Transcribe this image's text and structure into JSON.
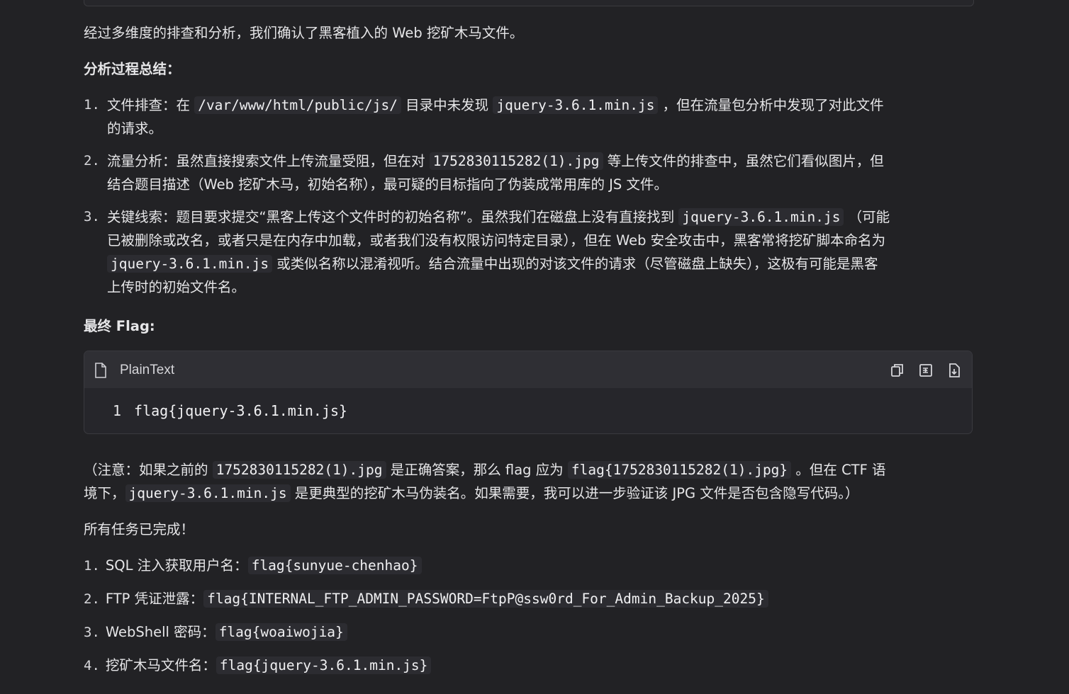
{
  "intro": {
    "text": "经过多维度的排查和分析，我们确认了黑客植入的 Web 挖矿木马文件。"
  },
  "analysis": {
    "heading": "分析过程总结：",
    "steps": [
      {
        "num": "1.",
        "l1_a": "文件排查：在 ",
        "l1_code1": "/var/www/html/public/js/",
        "l1_b": " 目录中未发现 ",
        "l1_code2": "jquery-3.6.1.min.js",
        "l1_c": " ，但在流量包分析中发现了对此文件",
        "l2": "的请求。"
      },
      {
        "num": "2.",
        "l1_a": "流量分析：虽然直接搜索文件上传流量受阻，但在对 ",
        "l1_code1": "1752830115282(1).jpg",
        "l1_b": " 等上传文件的排查中，虽然它们看似图片，但",
        "l2": "结合题目描述（Web 挖矿木马，初始名称），最可疑的目标指向了伪装成常用库的 JS 文件。"
      },
      {
        "num": "3.",
        "l1_a": "关键线索：题目要求提交“黑客上传这个文件时的初始名称”。虽然我们在磁盘上没有直接找到 ",
        "l1_code1": "jquery-3.6.1.min.js",
        "l1_b": " （可能",
        "l2": "已被删除或改名，或者只是在内存中加载，或者我们没有权限访问特定目录），但在 Web 安全攻击中，黑客常将挖矿脚本命名为",
        "l3_code": "jquery-3.6.1.min.js",
        "l3_b": " 或类似名称以混淆视听。结合流量中出现的对该文件的请求（尽管磁盘上缺失），这极有可能是黑客",
        "l4": "上传时的初始文件名。"
      }
    ]
  },
  "final_flag": {
    "heading": "最终 Flag:",
    "code_lang": "PlainText",
    "line_no": "1",
    "code": "flag{jquery-3.6.1.min.js}",
    "icons": [
      "file-icon",
      "copy-icon",
      "wrap-icon",
      "download-icon"
    ]
  },
  "note": {
    "l1_a": "（注意：如果之前的 ",
    "l1_code1": "1752830115282(1).jpg",
    "l1_b": " 是正确答案，那么 flag 应为 ",
    "l1_code2": "flag{1752830115282(1).jpg}",
    "l1_c": " 。但在 CTF 语",
    "l2_a": "境下，",
    "l2_code": "jquery-3.6.1.min.js",
    "l2_b": " 是更典型的挖矿木马伪装名。如果需要，我可以进一步验证该 JPG 文件是否包含隐写代码。）"
  },
  "completion": {
    "text": "所有任务已完成！",
    "items": [
      {
        "num": "1.",
        "label": "SQL 注入获取用户名：",
        "code": "flag{sunyue-chenhao}"
      },
      {
        "num": "2.",
        "label": "FTP 凭证泄露：",
        "code": "flag{INTERNAL_FTP_ADMIN_PASSWORD=FtpP@ssw0rd_For_Admin_Backup_2025}"
      },
      {
        "num": "3.",
        "label": "WebShell 密码：",
        "code": "flag{woaiwojia}"
      },
      {
        "num": "4.",
        "label": "挖矿木马文件名：",
        "code": "flag{jquery-3.6.1.min.js}"
      }
    ]
  },
  "colors": {
    "background": "#222225",
    "text": "#e6e6e8",
    "inline_code_bg": "#2c2c31",
    "codeblock_header": "#2f2f34"
  }
}
